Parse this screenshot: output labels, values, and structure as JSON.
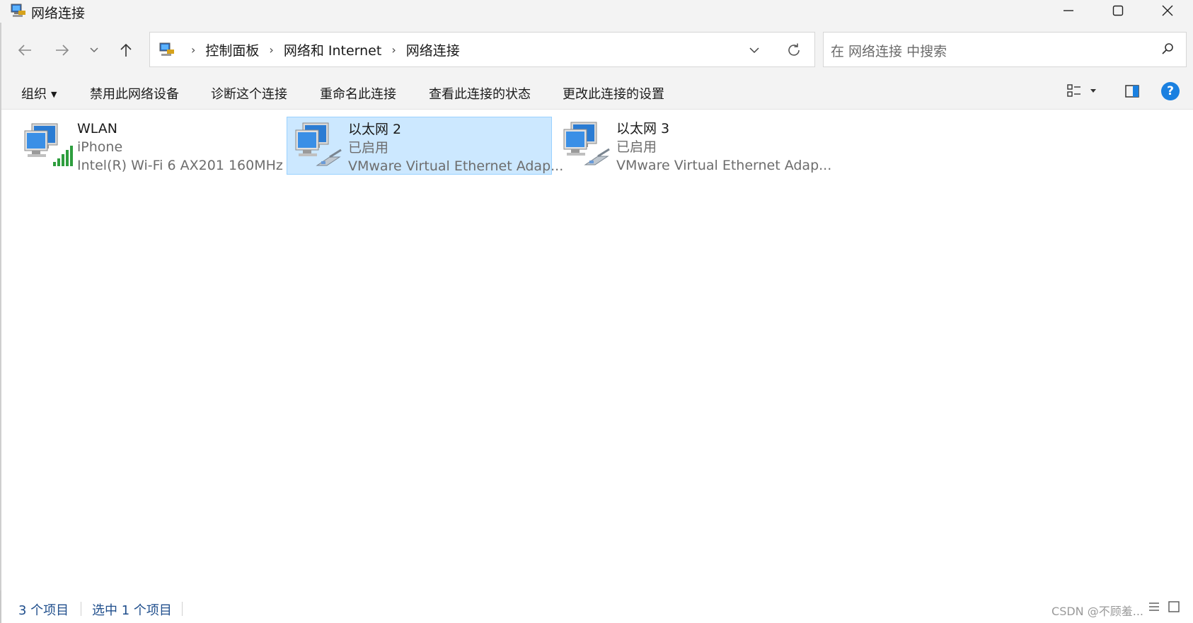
{
  "window": {
    "title": "网络连接",
    "app_icon": "network-connections-icon",
    "controls": [
      "minimize-icon",
      "maximize-icon",
      "close-icon"
    ]
  },
  "navigation": {
    "back_icon": "arrow-left-icon",
    "forward_icon": "arrow-right-icon",
    "recent_icon": "chevron-down-icon",
    "up_icon": "arrow-up-icon",
    "breadcrumb": [
      "控制面板",
      "网络和 Internet",
      "网络连接"
    ],
    "search_placeholder": "在 网络连接 中搜索"
  },
  "commandbar": {
    "organize": "组织",
    "disable": "禁用此网络设备",
    "diagnose": "诊断这个连接",
    "rename": "重命名此连接",
    "view_status": "查看此连接的状态",
    "change_settings": "更改此连接的设置"
  },
  "items": [
    {
      "name": "WLAN",
      "status": "iPhone",
      "device": "Intel(R) Wi-Fi 6 AX201 160MHz",
      "icon": "wifi-adapter-icon",
      "selected": false
    },
    {
      "name": "以太网 2",
      "status": "已启用",
      "device": "VMware Virtual Ethernet Adap...",
      "icon": "ethernet-adapter-icon",
      "selected": true
    },
    {
      "name": "以太网 3",
      "status": "已启用",
      "device": "VMware Virtual Ethernet Adap...",
      "icon": "ethernet-adapter-icon",
      "selected": false
    }
  ],
  "statusbar": {
    "count": "3 个项目",
    "selected": "选中 1 个项目",
    "watermark": "CSDN @不顾羞..."
  },
  "colors": {
    "selection_bg": "#cce8ff",
    "selection_border": "#99d1ff",
    "status_text": "#1f4e8c",
    "help_blue": "#1a80e0"
  }
}
